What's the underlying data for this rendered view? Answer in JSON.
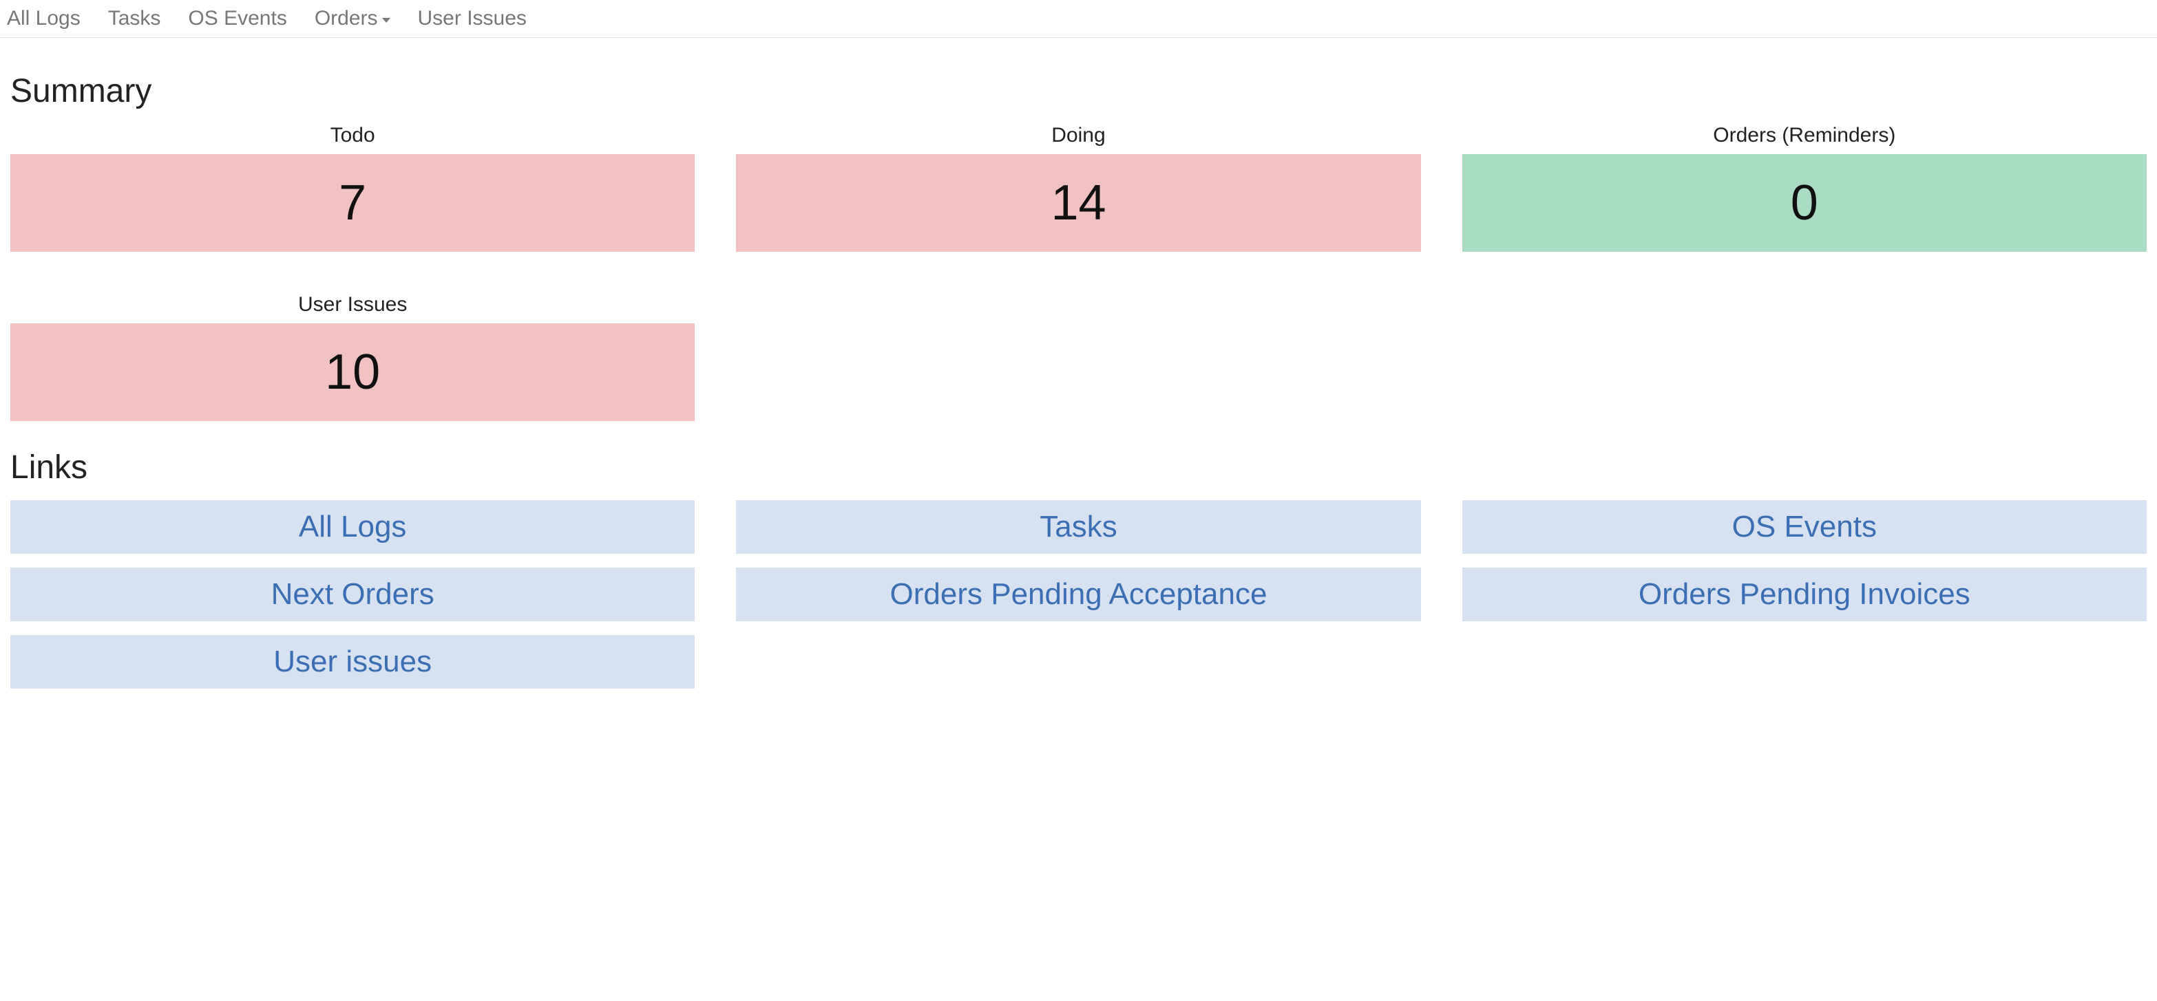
{
  "nav": {
    "all_logs": "All Logs",
    "tasks": "Tasks",
    "os_events": "OS Events",
    "orders": "Orders",
    "user_issues": "User Issues"
  },
  "sections": {
    "summary_title": "Summary",
    "links_title": "Links"
  },
  "summary": {
    "cards": [
      {
        "label": "Todo",
        "value": "7",
        "color": "bg-red"
      },
      {
        "label": "Doing",
        "value": "14",
        "color": "bg-red"
      },
      {
        "label": "Orders (Reminders)",
        "value": "0",
        "color": "bg-green"
      },
      {
        "label": "User Issues",
        "value": "10",
        "color": "bg-red"
      }
    ]
  },
  "links": {
    "items": [
      "All Logs",
      "Tasks",
      "OS Events",
      "Next Orders",
      "Orders Pending Acceptance",
      "Orders Pending Invoices",
      "User issues"
    ]
  }
}
